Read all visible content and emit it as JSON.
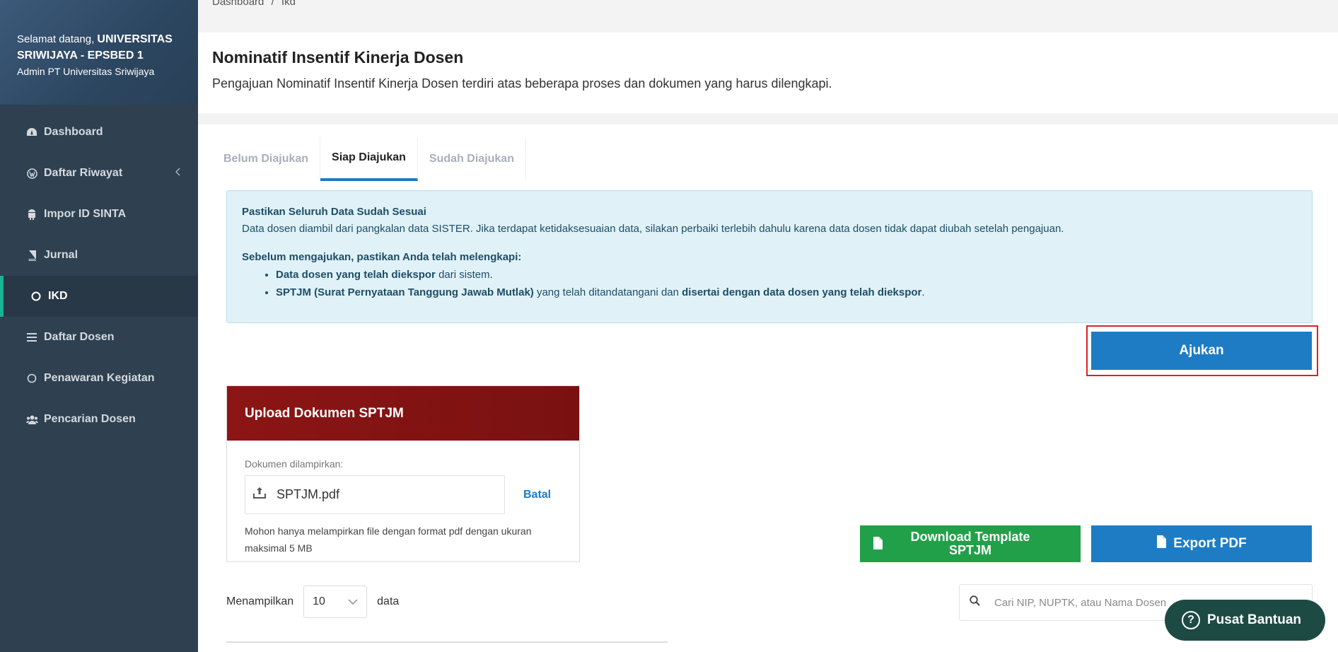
{
  "sidebar": {
    "welcome_prefix": "Selamat datang,",
    "institution": "UNIVERSITAS SRIWIJAYA - EPSBED 1",
    "role": "Admin PT Universitas Sriwijaya",
    "items": [
      {
        "label": "Dashboard",
        "icon": "dashboard-icon"
      },
      {
        "label": "Daftar Riwayat",
        "icon": "wordpress-icon"
      },
      {
        "label": "Impor ID SINTA",
        "icon": "android-icon"
      },
      {
        "label": "Jurnal",
        "icon": "book-icon"
      },
      {
        "label": "IKD",
        "icon": "circle-icon"
      },
      {
        "label": "Daftar Dosen",
        "icon": "list-icon"
      },
      {
        "label": "Penawaran Kegiatan",
        "icon": "circle-icon"
      },
      {
        "label": "Pencarian Dosen",
        "icon": "users-icon"
      }
    ]
  },
  "breadcrumb": {
    "home": "Dashboard",
    "sep": "/",
    "current": "Ikd"
  },
  "header": {
    "title": "Nominatif Insentif Kinerja Dosen",
    "subtitle": "Pengajuan Nominatif Insentif Kinerja Dosen terdiri atas beberapa proses dan dokumen yang harus dilengkapi."
  },
  "tabs": [
    {
      "label": "Belum Diajukan"
    },
    {
      "label": "Siap Diajukan"
    },
    {
      "label": "Sudah Diajukan"
    }
  ],
  "alert": {
    "title": "Pastikan Seluruh Data Sudah Sesuai",
    "desc": "Data dosen diambil dari pangkalan data SISTER. Jika terdapat ketidaksesuaian data, silakan perbaiki terlebih dahulu karena data dosen tidak dapat diubah setelah pengajuan.",
    "checklist_title": "Sebelum mengajukan, pastikan Anda telah melengkapi:",
    "item1_bold": "Data dosen yang telah diekspor",
    "item1_rest": " dari sistem.",
    "item2_bold": "SPTJM (Surat Pernyataan Tanggung Jawab Mutlak)",
    "item2_mid": " yang telah ditandatangani dan ",
    "item2_bold2": "disertai dengan data dosen yang telah diekspor",
    "item2_end": "."
  },
  "ajukan_label": "Ajukan",
  "upload": {
    "title": "Upload Dokumen SPTJM",
    "label": "Dokumen dilampirkan:",
    "filename": "SPTJM.pdf",
    "cancel": "Batal",
    "note": "Mohon hanya melampirkan file dengan format pdf dengan ukuran maksimal 5 MB"
  },
  "download_label": "Download Template SPTJM",
  "export_label": "Export PDF",
  "table_controls": {
    "show_prefix": "Menampilkan",
    "page_size": "10",
    "show_suffix": "data",
    "search_placeholder": "Cari NIP, NUPTK, atau Nama Dosen"
  },
  "help_label": "Pusat Bantuan",
  "colors": {
    "primary": "#1e7cc4",
    "success": "#22a049",
    "danger_header": "#8c1515",
    "sidebar": "#2f4050",
    "accent": "#1ab394"
  }
}
